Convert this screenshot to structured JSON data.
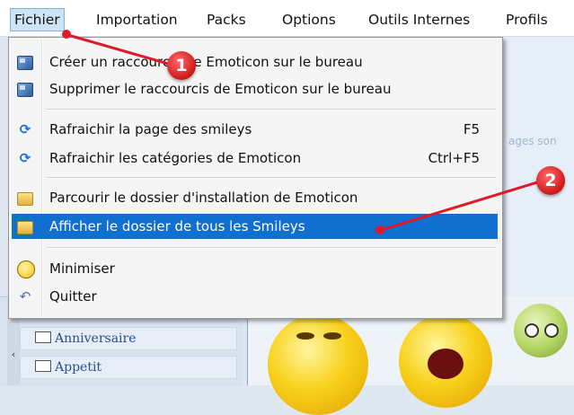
{
  "menubar": {
    "items": [
      "Fichier",
      "Importation",
      "Packs",
      "Options",
      "Outils Internes",
      "Profils"
    ]
  },
  "background": {
    "hint_text": "ages son",
    "categories": [
      "Anniversaire",
      "Appetit"
    ],
    "scroll_arrow": "‹"
  },
  "menu": {
    "items": [
      {
        "label": "Créer un raccourcis de Emoticon sur le bureau",
        "shortcut": "",
        "icon": "shortcut-icon"
      },
      {
        "label": "Supprimer le raccourcis de Emoticon sur le bureau",
        "shortcut": "",
        "icon": "shortcut-icon"
      },
      {
        "label": "Rafraichir la page des smileys",
        "shortcut": "F5",
        "icon": "refresh-icon"
      },
      {
        "label": "Rafraichir les catégories de Emoticon",
        "shortcut": "Ctrl+F5",
        "icon": "refresh-icon"
      },
      {
        "label": "Parcourir le dossier d'installation de Emoticon",
        "shortcut": "",
        "icon": "folder-icon"
      },
      {
        "label": "Afficher le dossier de tous les Smileys",
        "shortcut": "",
        "icon": "folder-icon"
      },
      {
        "label": "Minimiser",
        "shortcut": "",
        "icon": "minimize-smiley-icon"
      },
      {
        "label": "Quitter",
        "shortcut": "",
        "icon": "quit-arrow-icon"
      }
    ],
    "highlighted_index": 5
  },
  "annotations": {
    "badge1": "1",
    "badge2": "2",
    "color": "#e0192a"
  },
  "colors": {
    "highlight": "#1170cf",
    "menubar_active": "#cde4f7"
  }
}
